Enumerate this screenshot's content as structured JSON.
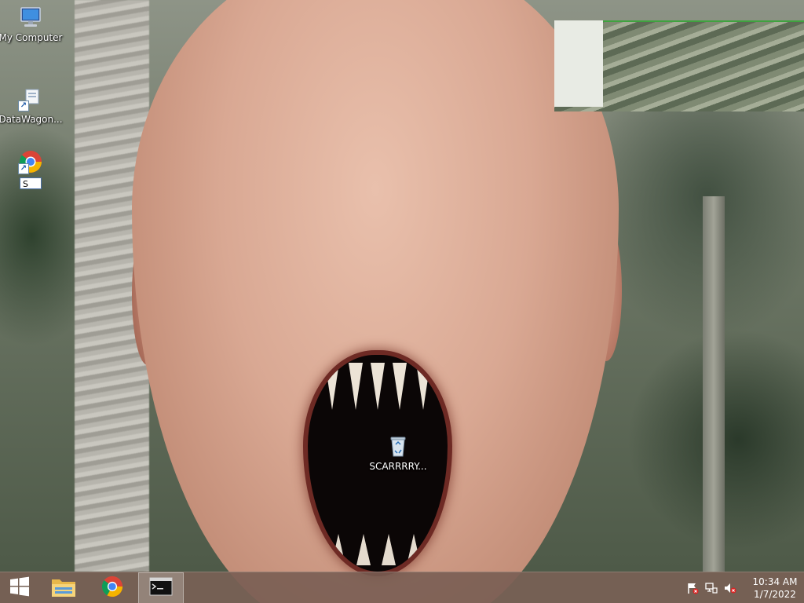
{
  "desktop": {
    "icons": [
      {
        "label": "My Computer",
        "icon": "computer-icon"
      },
      {
        "label": "DataWagon...",
        "icon": "shortcut-icon"
      },
      {
        "label": "",
        "icon": "chrome-shortcut-icon",
        "rename_value": "S"
      },
      {
        "label": "SCARRRRY...",
        "icon": "recycle-bin-icon"
      }
    ]
  },
  "taskbar": {
    "start_icon": "windows-logo-icon",
    "pinned": [
      {
        "name": "File Explorer",
        "icon": "folder-icon"
      },
      {
        "name": "Google Chrome",
        "icon": "chrome-icon"
      },
      {
        "name": "Command Prompt",
        "icon": "cmd-icon",
        "active": true
      }
    ],
    "tray": {
      "icons": [
        "action-center-flag-icon",
        "network-icon",
        "volume-muted-icon"
      ],
      "time": "10:34 AM",
      "date": "1/7/2022"
    }
  },
  "colors": {
    "taskbar_bg": "#765c52",
    "label_text": "#ffffff"
  }
}
